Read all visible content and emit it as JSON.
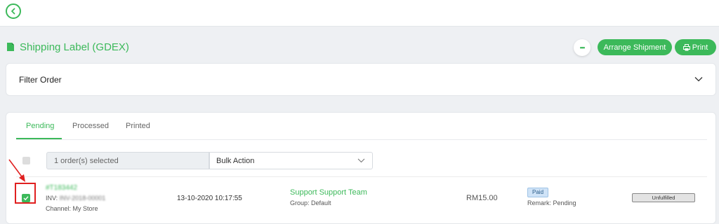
{
  "header": {
    "title": "Shipping Label (GDEX)",
    "more_label": "•••",
    "arrange_label": "Arrange Shipment",
    "print_label": "Print"
  },
  "filter": {
    "label": "Filter Order"
  },
  "tabs": [
    {
      "label": "Pending",
      "active": true
    },
    {
      "label": "Processed",
      "active": false
    },
    {
      "label": "Printed",
      "active": false
    }
  ],
  "bulk": {
    "selected_text": "1 order(s) selected",
    "action_label": "Bulk Action"
  },
  "order": {
    "id": "#T183442",
    "invoice_prefix": "INV: ",
    "invoice_value": "INV-2018-00001",
    "channel_prefix": "Channel: ",
    "channel_value": "My Store",
    "datetime": "13-10-2020 10:17:55",
    "customer": "Support Support Team",
    "group_prefix": "Group: ",
    "group_value": "Default",
    "amount": "RM15.00",
    "payment_status": "Paid",
    "remark_prefix": "Remark: ",
    "remark_value": "Pending",
    "fulfillment_status": "Unfulfilled",
    "checked": true
  },
  "colors": {
    "accent": "#3cb95a",
    "annotation": "#e02020",
    "paid_badge": "#cfe3f7"
  },
  "icons": {
    "back": "chevron-left-icon",
    "title": "document-icon",
    "print": "printer-icon",
    "filter_toggle": "chevron-down-icon",
    "bulk_toggle": "chevron-down-icon",
    "row_check": "checkmark-icon"
  }
}
